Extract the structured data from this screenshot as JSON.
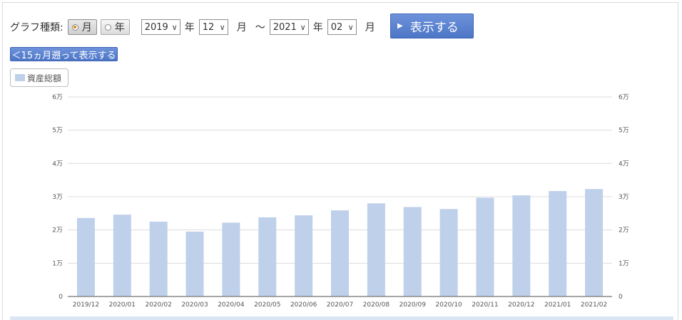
{
  "controls": {
    "graph_type_label": "グラフ種類:",
    "radio_month": "月",
    "radio_year": "年",
    "from_year": "2019",
    "from_month": "12",
    "to_year": "2021",
    "to_month": "02",
    "unit_year": "年",
    "unit_month": "月",
    "range_separator": "～",
    "show_button": "表示する",
    "back_button": "＜15ヵ月遡って表示する"
  },
  "legend": {
    "label": "資産総額"
  },
  "colors": {
    "bar": "#bfd0ea",
    "button": "#5a82cf",
    "grid": "#dcdcdc",
    "axis": "#888888"
  },
  "chart_data": {
    "type": "bar",
    "categories": [
      "2019/12",
      "2020/01",
      "2020/02",
      "2020/03",
      "2020/04",
      "2020/05",
      "2020/06",
      "2020/07",
      "2020/08",
      "2020/09",
      "2020/10",
      "2020/11",
      "2020/12",
      "2021/01",
      "2021/02"
    ],
    "series": [
      {
        "name": "資産総額",
        "values": [
          23600,
          24600,
          22500,
          19500,
          22200,
          23800,
          24400,
          25900,
          28000,
          26900,
          26300,
          29700,
          30400,
          31700,
          32300
        ]
      }
    ],
    "ylim": [
      0,
      60000
    ],
    "yticks": [
      0,
      10000,
      20000,
      30000,
      40000,
      50000,
      60000
    ],
    "ytick_labels": [
      "0",
      "1万",
      "2万",
      "3万",
      "4万",
      "5万",
      "6万"
    ],
    "grid": true,
    "secondary_y_axis": true
  }
}
